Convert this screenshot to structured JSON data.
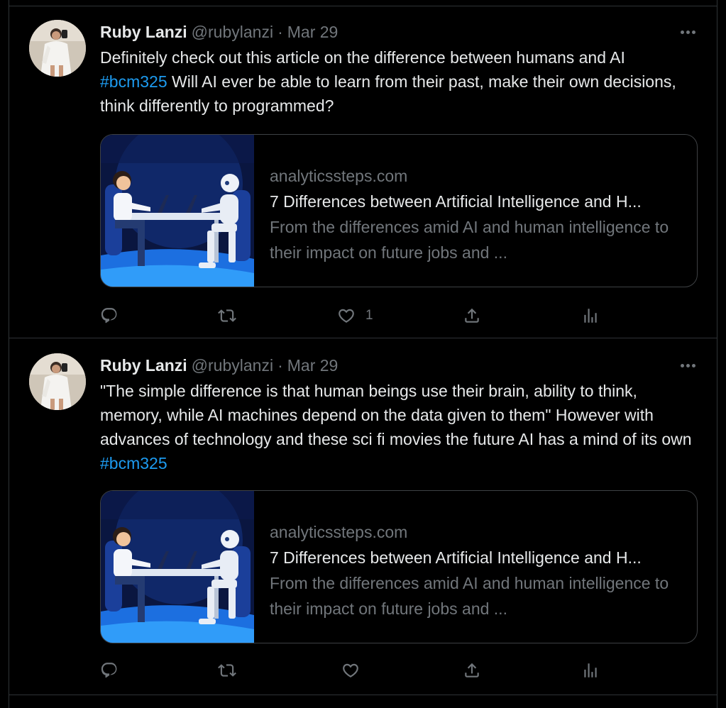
{
  "tweets": [
    {
      "author": {
        "name": "Ruby Lanzi",
        "handle": "@rubylanzi"
      },
      "separator": "·",
      "date": "Mar 29",
      "text_segments": [
        {
          "text": "Definitely check out this article on the difference between humans and AI ",
          "type": "text"
        },
        {
          "text": "#bcm325",
          "type": "hashtag"
        },
        {
          "text": " Will AI ever be able to learn from their past, make their own decisions, think differently to programmed?",
          "type": "text"
        }
      ],
      "card": {
        "domain": "analyticssteps.com",
        "title": "7 Differences between Artificial Intelligence and H...",
        "description": "From the differences amid AI and human intelligence to their impact on future jobs and ..."
      },
      "actions": {
        "reply": "",
        "retweet": "",
        "like": "1",
        "share": "",
        "analytics": ""
      }
    },
    {
      "author": {
        "name": "Ruby Lanzi",
        "handle": "@rubylanzi"
      },
      "separator": "·",
      "date": "Mar 29",
      "text_segments": [
        {
          "text": "\"The simple difference is that human beings use their brain, ability to think, memory, while AI machines depend on the data given to them\" However with advances of technology and these sci fi movies the future AI has a mind of its own ",
          "type": "text"
        },
        {
          "text": "#bcm325",
          "type": "hashtag"
        }
      ],
      "card": {
        "domain": "analyticssteps.com",
        "title": "7 Differences between Artificial Intelligence and H...",
        "description": "From the differences amid AI and human intelligence to their impact on future jobs and ..."
      },
      "actions": {
        "reply": "",
        "retweet": "",
        "like": "",
        "share": "",
        "analytics": ""
      }
    }
  ],
  "icons": [
    "more-icon",
    "reply-icon",
    "retweet-icon",
    "like-icon",
    "share-icon",
    "analytics-icon"
  ],
  "colors": {
    "background": "#000000",
    "text": "#e7e9ea",
    "secondary": "#71767b",
    "link": "#1d9bf0",
    "border": "#2f3336"
  }
}
